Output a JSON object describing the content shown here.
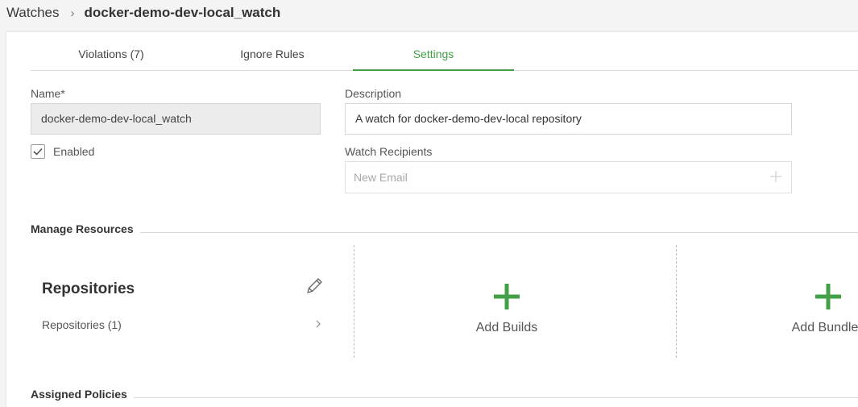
{
  "breadcrumb": {
    "parent": "Watches",
    "separator": "›",
    "current": "docker-demo-dev-local_watch"
  },
  "tabs": [
    {
      "label": "Violations (7)",
      "active": false
    },
    {
      "label": "Ignore Rules",
      "active": false
    },
    {
      "label": "Settings",
      "active": true
    }
  ],
  "form": {
    "name_label": "Name*",
    "name_value": "docker-demo-dev-local_watch",
    "enabled_label": "Enabled",
    "enabled_checked": true,
    "description_label": "Description",
    "description_value": "A watch for docker-demo-dev-local repository",
    "recipients_label": "Watch Recipients",
    "recipients_placeholder": "New Email"
  },
  "manage_resources": {
    "title": "Manage Resources",
    "repositories_title": "Repositories",
    "repositories_row": "Repositories (1)",
    "add_builds": "Add Builds",
    "add_bundles": "Add Bundles"
  },
  "assigned_policies": {
    "title": "Assigned Policies"
  },
  "colors": {
    "accent": "#43a047",
    "text": "#3a3a3a",
    "muted": "#a8a8a8",
    "border": "#d6d6d6"
  },
  "icons": [
    "breadcrumb-chevron-icon",
    "checkmark-icon",
    "plus-icon",
    "pencil-icon",
    "chevron-right-icon"
  ]
}
